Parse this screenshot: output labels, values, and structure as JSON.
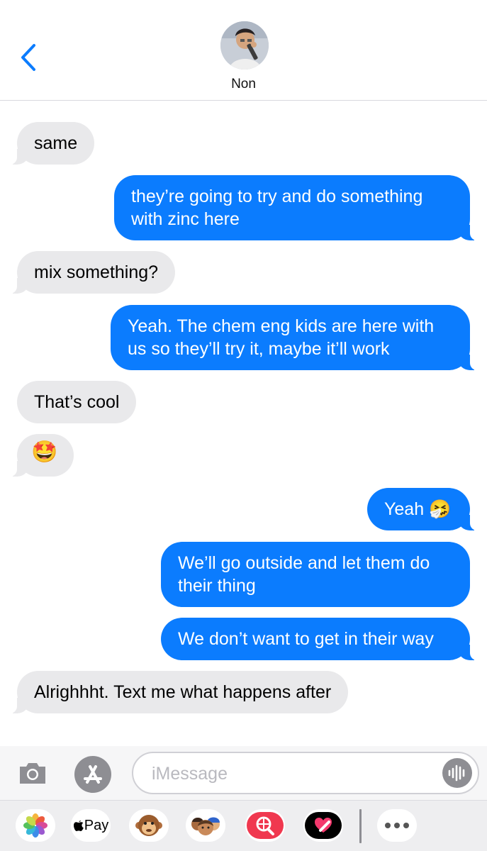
{
  "header": {
    "contact_name": "Non"
  },
  "messages": [
    {
      "from": "them",
      "text": "same"
    },
    {
      "from": "me",
      "text": "they’re going to try and do something with zinc here"
    },
    {
      "from": "them",
      "text": "mix something?"
    },
    {
      "from": "me",
      "text": "Yeah. The chem eng kids are here with us so they’ll try it, maybe it’ll work"
    },
    {
      "from": "them",
      "text": "That’s cool"
    },
    {
      "from": "them",
      "text": "🤩"
    },
    {
      "from": "me",
      "text": "Yeah 🤧"
    },
    {
      "from": "me",
      "text": "We’ll go outside and let them do their thing"
    },
    {
      "from": "me",
      "text": "We don’t want to get in their way"
    },
    {
      "from": "them",
      "text": "Alrighhht. Text me what happens after"
    }
  ],
  "composer": {
    "placeholder": "iMessage",
    "value": ""
  },
  "app_drawer": {
    "apple_pay_label": "Pay",
    "apps": [
      "photos-app",
      "apple-pay-app",
      "animoji-app",
      "memoji-app",
      "web-search-app",
      "digital-touch-app",
      "more-apps"
    ]
  },
  "colors": {
    "accent": "#0b7cfe",
    "incoming_bubble": "#e9e9eb",
    "outgoing_bubble": "#0b7cfe"
  }
}
